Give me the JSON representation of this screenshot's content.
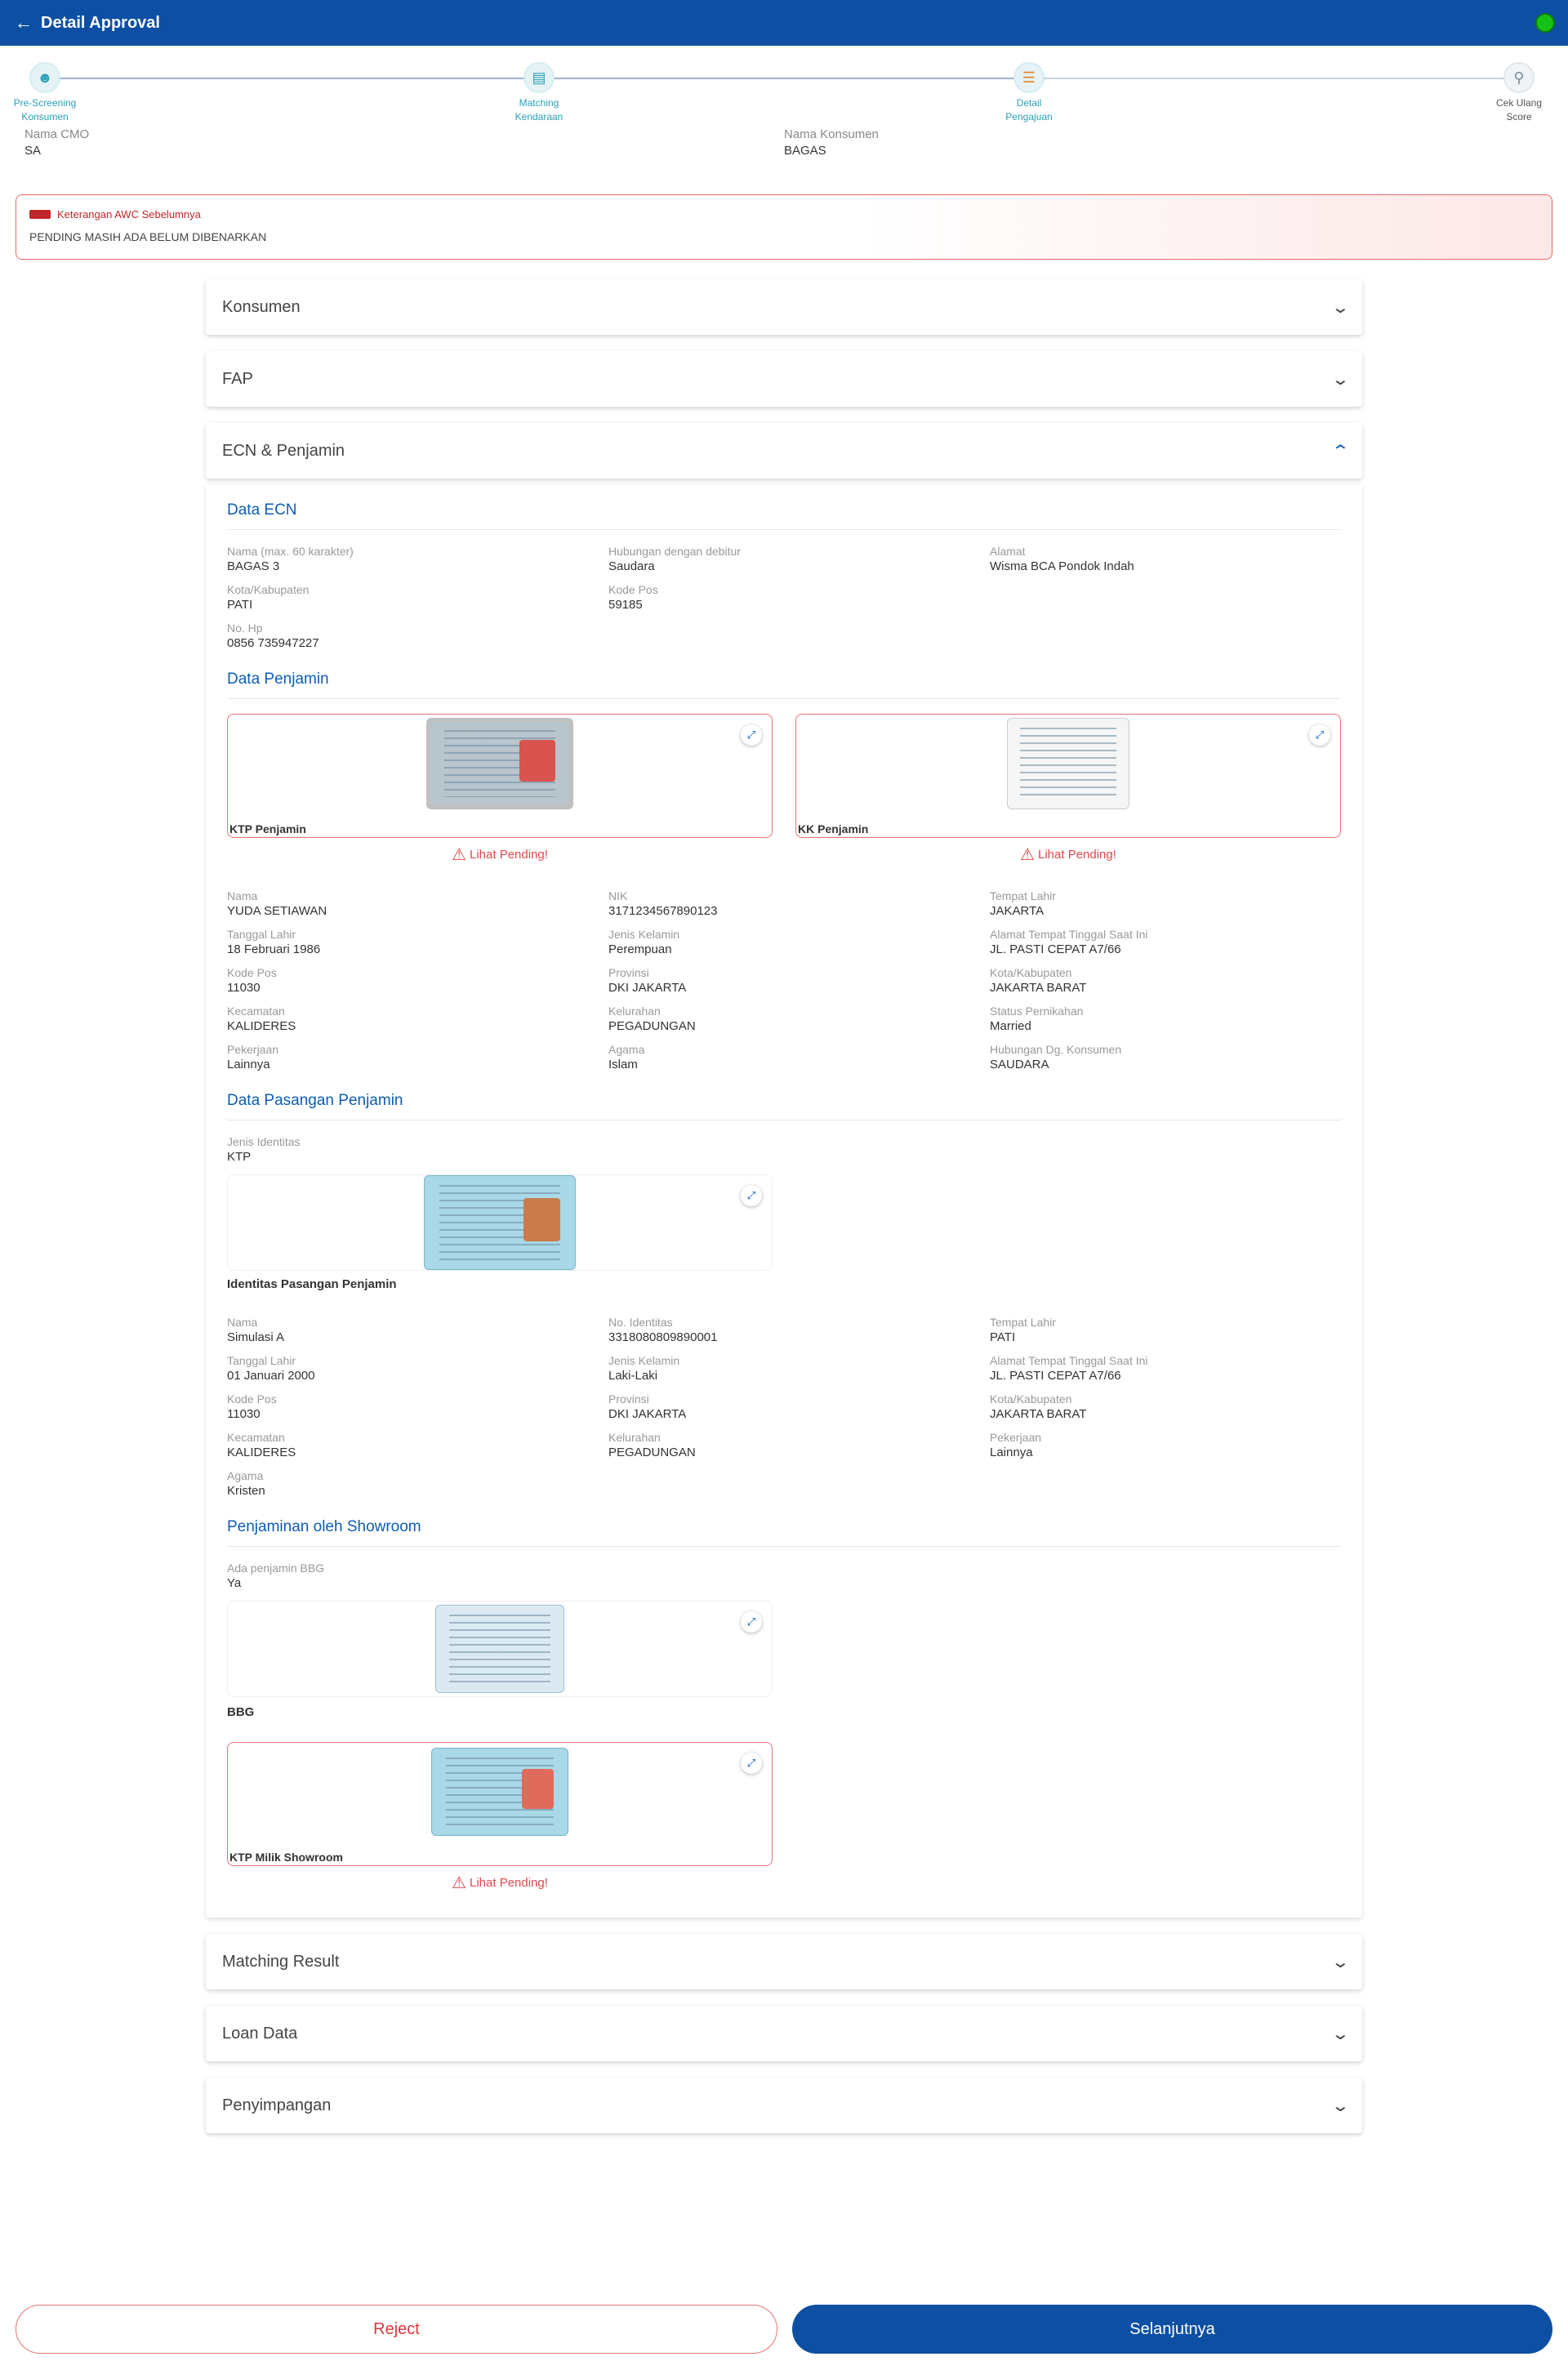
{
  "header": {
    "title": "Detail Approval"
  },
  "steps": [
    {
      "label1": "Pre-Screening",
      "label2": "Konsumen"
    },
    {
      "label1": "Matching",
      "label2": "Kendaraan"
    },
    {
      "label1": "Detail",
      "label2": "Pengajuan"
    },
    {
      "label1": "Cek Ulang",
      "label2": "Score"
    }
  ],
  "info": {
    "cmo_label": "Nama CMO",
    "cmo_value": "SA",
    "konsumen_label": "Nama Konsumen",
    "konsumen_value": "BAGAS"
  },
  "awc": {
    "title": "Keterangan AWC Sebelumnya",
    "message": "PENDING MASIH ADA BELUM DIBENARKAN"
  },
  "accordions": {
    "konsumen": "Konsumen",
    "fap": "FAP",
    "ecn": "ECN & Penjamin",
    "matching": "Matching Result",
    "loan": "Loan Data",
    "penyimpangan": "Penyimpangan"
  },
  "ecn": {
    "title": "Data ECN",
    "fields": [
      {
        "k": "Nama (max. 60 karakter)",
        "v": "BAGAS 3"
      },
      {
        "k": "Hubungan dengan debitur",
        "v": "Saudara"
      },
      {
        "k": "Alamat",
        "v": "Wisma BCA Pondok Indah"
      },
      {
        "k": "Kota/Kabupaten",
        "v": "PATI"
      },
      {
        "k": "Kode Pos",
        "v": "59185"
      },
      {
        "k": "No. Hp",
        "v": "0856 735947227"
      }
    ]
  },
  "penjamin": {
    "title": "Data Penjamin",
    "ktp_caption": "KTP Penjamin",
    "kk_caption": "KK Penjamin",
    "pending": "Lihat Pending!",
    "fields": [
      {
        "k": "Nama",
        "v": "YUDA SETIAWAN"
      },
      {
        "k": "NIK",
        "v": "3171234567890123"
      },
      {
        "k": "Tempat Lahir",
        "v": "JAKARTA"
      },
      {
        "k": "Tanggal Lahir",
        "v": "18 Februari 1986"
      },
      {
        "k": "Jenis Kelamin",
        "v": "Perempuan"
      },
      {
        "k": "Alamat Tempat Tinggal Saat Ini",
        "v": "JL. PASTI CEPAT A7/66"
      },
      {
        "k": "Kode Pos",
        "v": "11030"
      },
      {
        "k": "Provinsi",
        "v": "DKI JAKARTA"
      },
      {
        "k": "Kota/Kabupaten",
        "v": "JAKARTA BARAT"
      },
      {
        "k": "Kecamatan",
        "v": "KALIDERES"
      },
      {
        "k": "Kelurahan",
        "v": "PEGADUNGAN"
      },
      {
        "k": "Status Pernikahan",
        "v": "Married"
      },
      {
        "k": "Pekerjaan",
        "v": "Lainnya"
      },
      {
        "k": "Agama",
        "v": "Islam"
      },
      {
        "k": "Hubungan Dg. Konsumen",
        "v": "SAUDARA"
      }
    ]
  },
  "pasangan": {
    "title": "Data Pasangan Penjamin",
    "jenis_label": "Jenis Identitas",
    "jenis_value": "KTP",
    "caption": "Identitas Pasangan Penjamin",
    "fields": [
      {
        "k": "Nama",
        "v": "Simulasi A"
      },
      {
        "k": "No. Identitas",
        "v": "3318080809890001"
      },
      {
        "k": "Tempat Lahir",
        "v": "PATI"
      },
      {
        "k": "Tanggal Lahir",
        "v": "01 Januari 2000"
      },
      {
        "k": "Jenis Kelamin",
        "v": "Laki-Laki"
      },
      {
        "k": "Alamat Tempat Tinggal Saat Ini",
        "v": "JL. PASTI CEPAT A7/66"
      },
      {
        "k": "Kode Pos",
        "v": "11030"
      },
      {
        "k": "Provinsi",
        "v": "DKI JAKARTA"
      },
      {
        "k": "Kota/Kabupaten",
        "v": "JAKARTA BARAT"
      },
      {
        "k": "Kecamatan",
        "v": "KALIDERES"
      },
      {
        "k": "Kelurahan",
        "v": "PEGADUNGAN"
      },
      {
        "k": "Pekerjaan",
        "v": "Lainnya"
      },
      {
        "k": "Agama",
        "v": "Kristen"
      }
    ]
  },
  "showroom": {
    "title": "Penjaminan oleh Showroom",
    "bbg_label": "Ada penjamin BBG",
    "bbg_value": "Ya",
    "bbg_caption": "BBG",
    "ktp_caption": "KTP Milik Showroom",
    "pending": "Lihat Pending!"
  },
  "buttons": {
    "reject": "Reject",
    "next": "Selanjutnya"
  }
}
